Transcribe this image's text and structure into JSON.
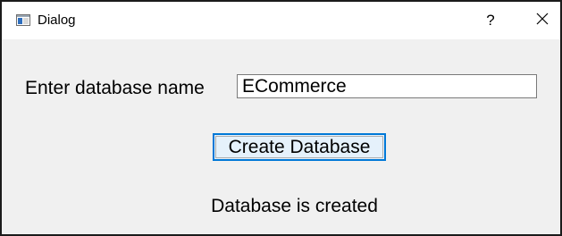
{
  "window": {
    "title": "Dialog",
    "help_glyph": "?",
    "close_glyph": "✕",
    "icon": "app-window-icon"
  },
  "form": {
    "label": "Enter database name",
    "input_value": "ECommerce",
    "button_label": "Create Database",
    "status": "Database is created"
  },
  "colors": {
    "accent": "#0078d7",
    "button_bg": "#e5f1fb",
    "dialog_bg": "#f0f0f0"
  }
}
